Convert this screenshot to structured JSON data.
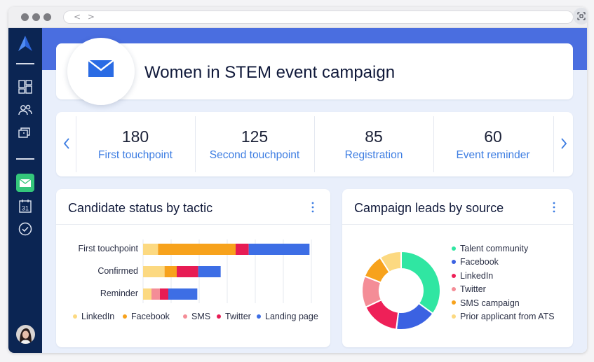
{
  "browser": {
    "nav_arrows": "< >",
    "scan_icon": "scan-icon"
  },
  "sidebar": {
    "logo": "logo-icon",
    "items": [
      {
        "name": "dashboard-icon"
      },
      {
        "name": "people-icon"
      },
      {
        "name": "briefcase-icon"
      },
      {
        "name": "envelope-icon",
        "active": true
      },
      {
        "name": "calendar-icon",
        "text": "31"
      },
      {
        "name": "check-circle-icon"
      }
    ]
  },
  "campaign": {
    "title": "Women in STEM event campaign"
  },
  "stats": [
    {
      "value": "180",
      "label": "First touchpoint"
    },
    {
      "value": "125",
      "label": "Second touchpoint"
    },
    {
      "value": "85",
      "label": "Registration"
    },
    {
      "value": "60",
      "label": "Event reminder"
    }
  ],
  "tactic_chart": {
    "title": "Candidate status by tactic",
    "chart_data": {
      "type": "bar",
      "orientation": "horizontal",
      "stacked": true,
      "categories": [
        "First touchpoint",
        "Confirmed",
        "Reminder"
      ],
      "series": [
        {
          "name": "LinkedIn",
          "color": "#fcd981",
          "values": [
            16,
            23,
            9
          ]
        },
        {
          "name": "Facebook",
          "color": "#f7a21c",
          "values": [
            83,
            13,
            0
          ]
        },
        {
          "name": "SMS",
          "color": "#f48d97",
          "values": [
            0,
            0,
            9
          ]
        },
        {
          "name": "Twitter",
          "color": "#e71c54",
          "values": [
            14,
            23,
            9
          ]
        },
        {
          "name": "Landing page",
          "color": "#3d6ee5",
          "values": [
            65,
            24,
            31
          ]
        }
      ],
      "xlim": [
        0,
        180
      ],
      "grid": true,
      "legend": "bottom"
    }
  },
  "source_chart": {
    "title": "Campaign leads by source",
    "chart_data": {
      "type": "pie",
      "donut": true,
      "labels": [
        "Talent community",
        "Facebook",
        "LinkedIn",
        "Twitter",
        "SMS campaign",
        "Prior applicant from ATS"
      ],
      "values": [
        35,
        17,
        16,
        13,
        10,
        9
      ],
      "colors": [
        "#30e6a2",
        "#3b62e2",
        "#ee2058",
        "#f48d97",
        "#f7a21c",
        "#fcd981"
      ],
      "legend": "right"
    }
  }
}
